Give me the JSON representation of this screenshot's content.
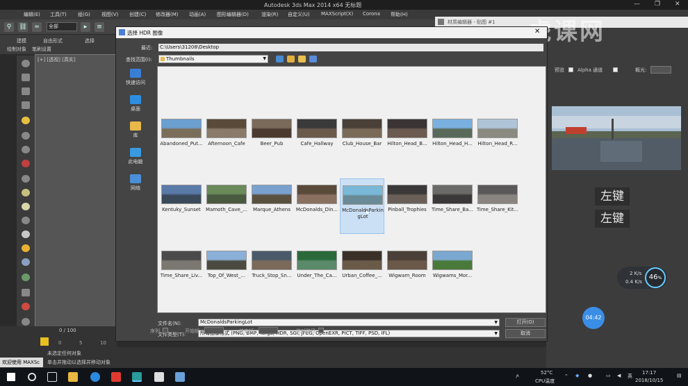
{
  "app": {
    "title": "Autodesk 3ds Max  2014 x64     无标题",
    "window_controls": [
      "—",
      "❐",
      "✕"
    ],
    "menu": [
      "编辑(E)",
      "工具(T)",
      "组(G)",
      "视图(V)",
      "创建(C)",
      "修改器(M)",
      "动画(A)",
      "图形编辑器(D)",
      "渲染(R)",
      "自定义(U)",
      "MAXScript(X)",
      "Corona",
      "帮助(H)"
    ],
    "selection_filter": "全部",
    "ribbon": {
      "tab_a": "建模",
      "tab_b": "自由形式",
      "tab_c": "选择",
      "tab_d": "绘制对象",
      "tab_e": "笔刷设置"
    },
    "viewport_label": "[+] [透视] [真实]",
    "timeline": "0 / 100",
    "timeline_ticks": [
      "0",
      "5",
      "10"
    ],
    "status_line1": "未选定任何对象",
    "status_line2": "单击并拖动以选择并移动对象",
    "welcome": "欢迎使用 MAXSc"
  },
  "material_editor": {
    "title": "材质编辑器 - 贴图 #1",
    "preview_label": "预览",
    "alpha_label": "Alpha 通道",
    "gamma_label": "概光:",
    "captions": [
      "左键",
      "左键"
    ],
    "perf": {
      "upload": "2 K/s",
      "download": "0.4 K/s",
      "percent": "46",
      "percent_unit": "%"
    },
    "timer": "04:42"
  },
  "watermark": "虎课网",
  "dialog": {
    "title": "选择 HDR 图像",
    "close": "✕",
    "recent_label": "最近:",
    "recent_path": "C:\\Users\\31208\\Desktop",
    "lookin_label": "查找范围(I):",
    "lookin_value": "Thumbnails",
    "places": [
      {
        "label": "快速访问",
        "color": "#3a7fd5"
      },
      {
        "label": "桌面",
        "color": "#2d8ee0"
      },
      {
        "label": "库",
        "color": "#e8b84a"
      },
      {
        "label": "此电脑",
        "color": "#3a9ae0"
      },
      {
        "label": "网络",
        "color": "#4a8fd8"
      }
    ],
    "files": [
      {
        "name": "Abandoned_Put...",
        "c1": "#6a9fd0",
        "c2": "#7a6e5a"
      },
      {
        "name": "Afternoon_Cafe",
        "c1": "#5a4a3a",
        "c2": "#8a7a6a"
      },
      {
        "name": "Beer_Pub",
        "c1": "#7a6a5a",
        "c2": "#4a3a30"
      },
      {
        "name": "Cafe_Hallway",
        "c1": "#3a3a3a",
        "c2": "#6a5a4a"
      },
      {
        "name": "Club_House_Bar",
        "c1": "#4a4038",
        "c2": "#7a6a58"
      },
      {
        "name": "Hilton_Head_B...",
        "c1": "#3a3434",
        "c2": "#6a5a50"
      },
      {
        "name": "Hilton_Head_H...",
        "c1": "#7ab0e0",
        "c2": "#5a6a5a"
      },
      {
        "name": "Hilton_Head_R...",
        "c1": "#b0c4d8",
        "c2": "#8a8a80"
      },
      {
        "name": "Kentuky_Sunset",
        "c1": "#5a7aa8",
        "c2": "#3a4a5a"
      },
      {
        "name": "Mamoth_Cave_...",
        "c1": "#6a8a5a",
        "c2": "#4a5a40"
      },
      {
        "name": "Marque_Athens",
        "c1": "#7aa0d0",
        "c2": "#5a5040"
      },
      {
        "name": "McDonalds_Din...",
        "c1": "#5a4a3a",
        "c2": "#8a7060"
      },
      {
        "name": "McDonaldsParkingLot",
        "c1": "#7ab8d8",
        "c2": "#6a8a98",
        "selected": true
      },
      {
        "name": "Pinball_Trophies",
        "c1": "#3a3838",
        "c2": "#6a6058"
      },
      {
        "name": "Time_Share_Ba...",
        "c1": "#6a6a68",
        "c2": "#3a3838"
      },
      {
        "name": "Time_Share_Kit...",
        "c1": "#5a5858",
        "c2": "#8a8480"
      },
      {
        "name": "Time_Share_Liv...",
        "c1": "#4a4a4a",
        "c2": "#7a7870"
      },
      {
        "name": "Top_Of_West_...",
        "c1": "#8ab0d8",
        "c2": "#4a4a40"
      },
      {
        "name": "Truck_Stop_Sn...",
        "c1": "#4a5a6a",
        "c2": "#7a6a5a"
      },
      {
        "name": "Under_The_Ca...",
        "c1": "#2a6a3a",
        "c2": "#5a8a6a"
      },
      {
        "name": "Urban_Coffee_...",
        "c1": "#3a3028",
        "c2": "#6a5a48"
      },
      {
        "name": "Wigwam_Room",
        "c1": "#4a4038",
        "c2": "#6a5848"
      },
      {
        "name": "Wigwams_Mor...",
        "c1": "#7aa8d0",
        "c2": "#4a7a3a"
      }
    ],
    "filename_label": "文件名(N):",
    "filename_value": "McDonaldsParkingLot",
    "filetype_label": "文件类型(T):",
    "filetype_value": "所有图像格式 (PNG, BMP, Targa, HDR, SGI, JPEG, OpenEXR, PICT, TIFF, PSD, IFL)",
    "open_button": "打开(O)",
    "cancel_button": "取消",
    "sequence_label": "序列",
    "start_label": "开始帧:",
    "end_label": "结束帧:",
    "gamma_label": "绝对路径"
  },
  "taskbar": {
    "temp": "52°C",
    "temp_label": "CPU温度",
    "ime": "英",
    "time": "17:17",
    "date": "2018/10/15"
  }
}
